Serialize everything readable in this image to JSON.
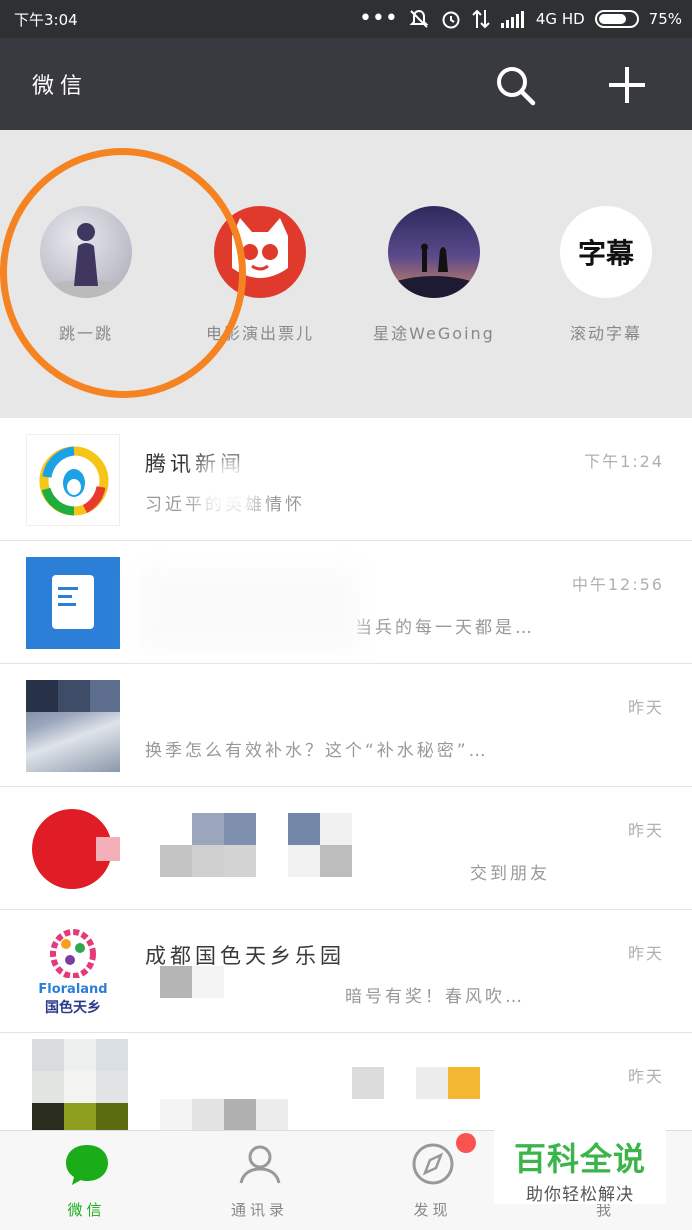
{
  "status_bar": {
    "time": "下午3:04",
    "network": "4G HD",
    "battery_pct": "75%",
    "battery_level": 0.75,
    "icons": [
      "more-icon",
      "mute-icon",
      "alarm-icon",
      "data-transfer-icon",
      "signal-icon",
      "battery-icon"
    ]
  },
  "header": {
    "title": "微信",
    "search_icon": "search-icon",
    "add_icon": "plus-icon"
  },
  "mini_programs": [
    {
      "label": "跳一跳",
      "icon": "jump-game-icon"
    },
    {
      "label": "电影演出票儿",
      "icon": "cat-face-icon"
    },
    {
      "label": "星途WeGoing",
      "icon": "night-sky-icon"
    },
    {
      "label": "滚动字幕",
      "icon": "subtitle-icon",
      "icon_text": "字幕"
    }
  ],
  "chats": [
    {
      "name": "腾讯新闻",
      "preview": "习近平的英雄情怀",
      "time": "下午1:24",
      "avatar": "qq-news-icon"
    },
    {
      "name": "",
      "preview": "当兵的每一天都是…",
      "time": "中午12:56",
      "avatar": "document-icon"
    },
    {
      "name": "",
      "preview": "换季怎么有效补水？这个“补水秘密”…",
      "time": "昨天",
      "avatar": "train-photo"
    },
    {
      "name": "",
      "preview": "交到朋友",
      "time": "昨天",
      "avatar": "red-brand-logo"
    },
    {
      "name": "成都国色天乡乐园",
      "preview": "暗号有奖！春风吹…",
      "time": "昨天",
      "avatar": "floraland-logo",
      "logo_text": "Floraland",
      "logo_sub": "国色天乡"
    },
    {
      "name": "",
      "preview": "",
      "time": "昨天",
      "avatar": "pixelated-avatar"
    }
  ],
  "tabs": [
    {
      "label": "微信",
      "icon": "chat-bubble-icon",
      "active": true
    },
    {
      "label": "通讯录",
      "icon": "contacts-icon",
      "active": false
    },
    {
      "label": "发现",
      "icon": "compass-icon",
      "active": false
    },
    {
      "label": "我",
      "icon": "person-icon",
      "active": false
    }
  ],
  "watermark": {
    "title": "百科全说",
    "subtitle": "助你轻松解决"
  },
  "colors": {
    "accent": "#1aad19",
    "annotation": "#f58321",
    "badge": "#fa5151",
    "header": "#393a3f"
  }
}
